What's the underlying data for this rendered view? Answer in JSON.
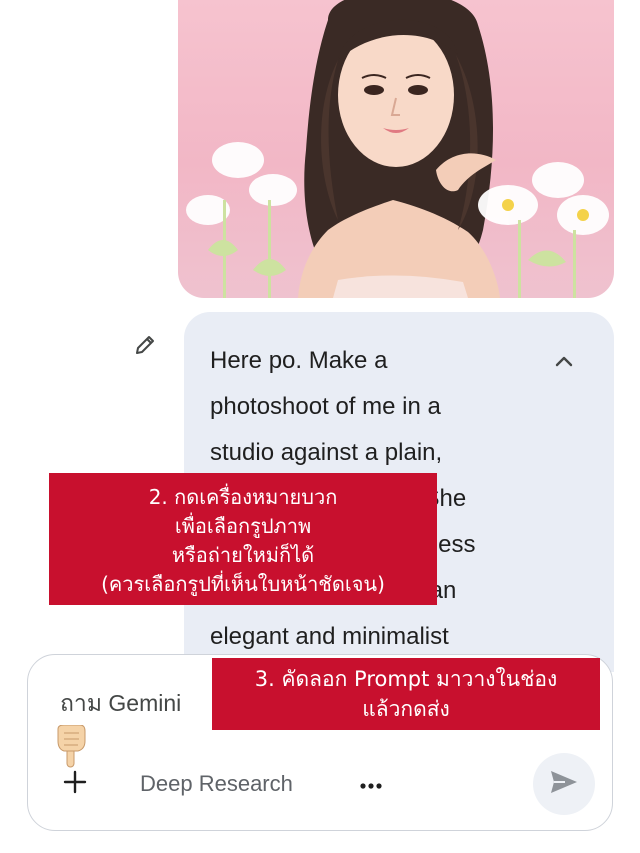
{
  "message": {
    "text": "Here po. Make a\nphotoshoot of me in a\nstudio against a plain,\nlight pink backdrop. She\nwears a white sleeveless\ndress that shows off an\nelegant and minimalist"
  },
  "composer": {
    "placeholder": "ถาม Gemini",
    "deep_research_label": "Deep Research",
    "add_icon": "plus-icon",
    "more_icon": "more-horizontal-icon",
    "send_icon": "send-icon"
  },
  "annotations": {
    "step2": "2. กดเครื่องหมายบวก\nเพื่อเลือกรูปภาพ\nหรือถ่ายใหม่ก็ได้\n(ควรเลือกรูปที่เห็นใบหน้าชัดเจน)",
    "step3": "3. คัดลอก Prompt มาวางในช่อง\nแล้วกดส่ง"
  },
  "colors": {
    "bubble": "#e9edf5",
    "annotation": "#c8102e",
    "photo_background": "#f4bccb"
  }
}
